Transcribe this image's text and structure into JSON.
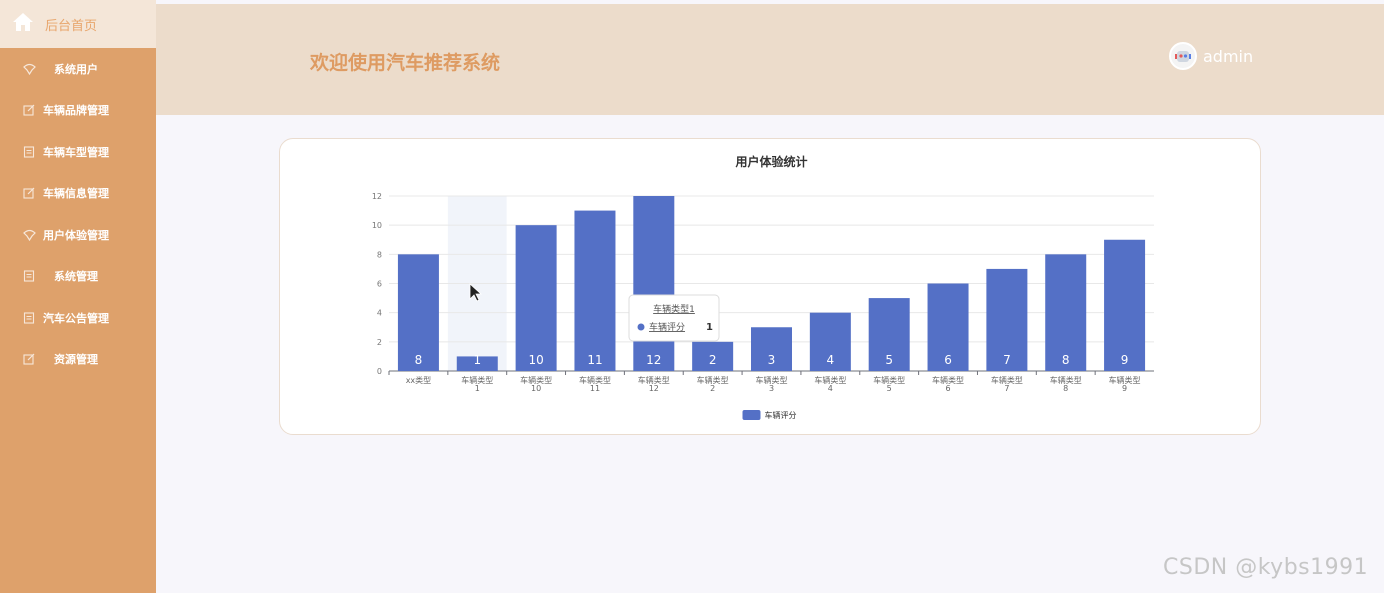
{
  "sidebar": {
    "home_label": "后台首页",
    "items": [
      {
        "label": "系统用户",
        "icon": "chat-icon"
      },
      {
        "label": "车辆品牌管理",
        "icon": "edit-icon"
      },
      {
        "label": "车辆车型管理",
        "icon": "doc-icon"
      },
      {
        "label": "车辆信息管理",
        "icon": "edit-icon"
      },
      {
        "label": "用户体验管理",
        "icon": "chat-icon"
      },
      {
        "label": "系统管理",
        "icon": "doc-icon"
      },
      {
        "label": "汽车公告管理",
        "icon": "doc-icon"
      },
      {
        "label": "资源管理",
        "icon": "edit-icon"
      }
    ]
  },
  "header": {
    "title": "欢迎使用汽车推荐系统",
    "username": "admin"
  },
  "tooltip": {
    "title": "车辆类型1",
    "series": "车辆评分",
    "value": "1"
  },
  "watermark": "CSDN @kybs1991",
  "colors": {
    "bar": "#5470c6",
    "sidebar": "#dea16b",
    "header": "#ecdccb",
    "title": "#de9b62"
  },
  "chart_data": {
    "type": "bar",
    "title": "用户体验统计",
    "categories": [
      "xx类型",
      "车辆类型\n1",
      "车辆类型\n10",
      "车辆类型\n11",
      "车辆类型\n12",
      "车辆类型\n2",
      "车辆类型\n3",
      "车辆类型\n4",
      "车辆类型\n5",
      "车辆类型\n6",
      "车辆类型\n7",
      "车辆类型\n8",
      "车辆类型\n9"
    ],
    "series": [
      {
        "name": "车辆评分",
        "values": [
          8,
          1,
          10,
          11,
          12,
          2,
          3,
          4,
          5,
          6,
          7,
          8,
          9
        ]
      }
    ],
    "ylim": [
      0,
      12
    ],
    "yticks": [
      0,
      2,
      4,
      6,
      8,
      10,
      12
    ],
    "grid": true,
    "legend": "bottom-center",
    "highlighted_category": 1
  }
}
